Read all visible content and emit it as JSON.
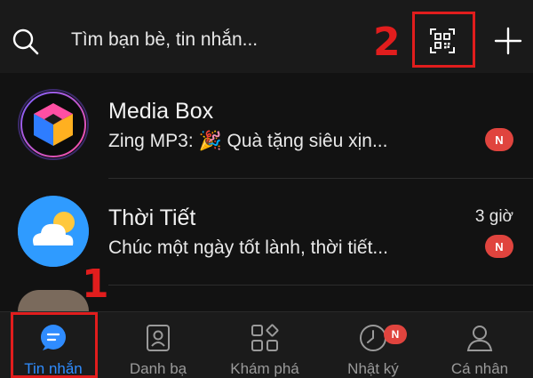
{
  "search": {
    "placeholder": "Tìm bạn bè, tin nhắn..."
  },
  "conversations": [
    {
      "title": "Media Box",
      "preview": "Zing MP3: 🎉 Quà tặng siêu xịn...",
      "time": "",
      "badge": "N"
    },
    {
      "title": "Thời Tiết",
      "preview": "Chúc một ngày tốt lành, thời tiết...",
      "time": "3 giờ",
      "badge": "N"
    }
  ],
  "nav": {
    "items": [
      {
        "label": "Tin nhắn",
        "icon": "chat-icon",
        "active": true
      },
      {
        "label": "Danh bạ",
        "icon": "contacts-icon",
        "active": false
      },
      {
        "label": "Khám phá",
        "icon": "discover-icon",
        "active": false
      },
      {
        "label": "Nhật ký",
        "icon": "clock-icon",
        "active": false,
        "badge": "N"
      },
      {
        "label": "Cá nhân",
        "icon": "person-icon",
        "active": false
      }
    ]
  },
  "annotations": {
    "one": "1",
    "two": "2"
  },
  "colors": {
    "accent": "#2f8cff",
    "badge": "#e0443e",
    "annotation": "#e11d1d",
    "background": "#121212"
  }
}
